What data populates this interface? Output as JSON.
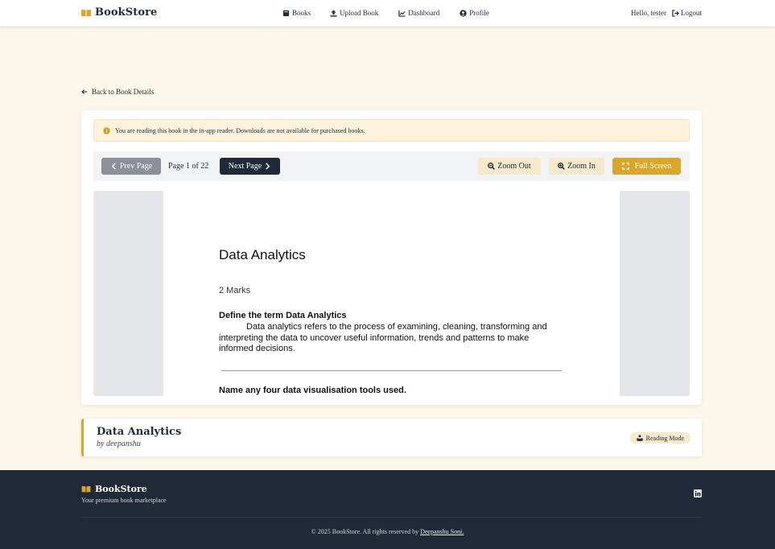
{
  "navbar": {
    "brand": "BookStore",
    "links": [
      {
        "label": "Books",
        "icon": "book-icon"
      },
      {
        "label": "Upload Book",
        "icon": "upload-icon"
      },
      {
        "label": "Dashboard",
        "icon": "chart-icon"
      },
      {
        "label": "Profile",
        "icon": "user-circle-icon"
      }
    ],
    "greeting": "Hello, tester",
    "logout_label": "Logout"
  },
  "back_link": "Back to Book Details",
  "reader": {
    "alert_text": "You are reading this book in the in-app reader. Downloads are not available for purchased books.",
    "prev_label": "Prev Page",
    "next_label": "Next Page",
    "page_indicator": "Page 1 of 22",
    "zoom_out_label": "Zoom Out",
    "zoom_in_label": "Zoom In",
    "fullscreen_label": "Full Screen",
    "page": {
      "title": "Data Analytics",
      "marks": "2 Marks",
      "question1": "Define the term Data Analytics",
      "answer1": "Data analytics refers to the process of examining, cleaning, transforming and interpreting the data to uncover useful information, trends and patterns to make informed decisions.",
      "question2": "Name any four data visualisation tools used."
    }
  },
  "book": {
    "title": "Data Analytics",
    "author": "by deepanshu",
    "mode_label": "Reading Mode"
  },
  "footer": {
    "brand": "BookStore",
    "tagline": "Your premium book marketplace",
    "copyright_prefix": "© 2025 BookStore. All rights reserved by",
    "author_link": "Deepanshu Soni."
  },
  "colors": {
    "accent": "#dba72a",
    "dark": "#1f2937",
    "background": "#fdf6ea"
  }
}
